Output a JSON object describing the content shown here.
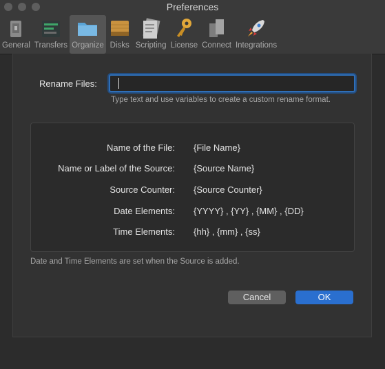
{
  "window": {
    "title": "Preferences"
  },
  "toolbar": {
    "items": [
      {
        "label": "General",
        "icon": "general-icon"
      },
      {
        "label": "Transfers",
        "icon": "transfers-icon"
      },
      {
        "label": "Organize",
        "icon": "folder-icon",
        "selected": true
      },
      {
        "label": "Disks",
        "icon": "disk-icon"
      },
      {
        "label": "Scripting",
        "icon": "script-icon"
      },
      {
        "label": "License",
        "icon": "key-icon"
      },
      {
        "label": "Connect",
        "icon": "connect-icon"
      },
      {
        "label": "Integrations",
        "icon": "rocket-icon"
      }
    ]
  },
  "rename": {
    "label": "Rename Files:",
    "value": "",
    "help": "Type text and use variables to create a custom rename format."
  },
  "variables": [
    {
      "name": "Name of the File:",
      "value": "{File Name}"
    },
    {
      "name": "Name or Label of the Source:",
      "value": "{Source Name}"
    },
    {
      "name": "Source Counter:",
      "value": "{Source Counter}"
    },
    {
      "name": "Date Elements:",
      "value": "{YYYY} , {YY} , {MM} , {DD}"
    },
    {
      "name": "Time Elements:",
      "value": "{hh} , {mm} , {ss}"
    }
  ],
  "note": "Date and Time Elements are set when the Source is added.",
  "buttons": {
    "cancel": "Cancel",
    "ok": "OK"
  },
  "colors": {
    "accent": "#2a6fcf",
    "focus_ring": "#2f6fb8"
  }
}
